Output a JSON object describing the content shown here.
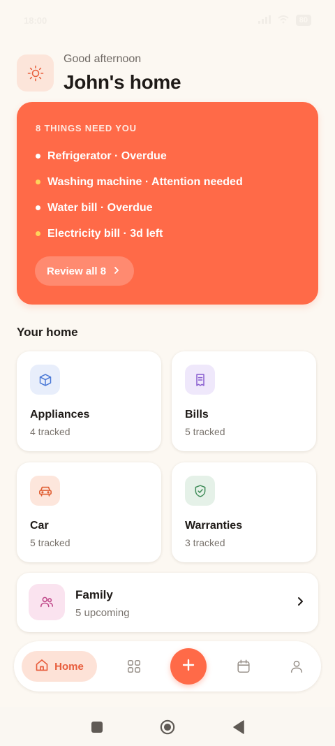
{
  "status_bar": {
    "time": "18:00",
    "battery": "80"
  },
  "header": {
    "greeting": "Good afternoon",
    "title": "John's home"
  },
  "alerts": {
    "heading": "8 THINGS NEED YOU",
    "items": [
      {
        "text": "Refrigerator · Overdue",
        "dot_color": "#FFFFFF"
      },
      {
        "text": "Washing machine · Attention needed",
        "dot_color": "#FFD35C"
      },
      {
        "text": "Water bill · Overdue",
        "dot_color": "#FFFFFF"
      },
      {
        "text": "Electricity bill · 3d left",
        "dot_color": "#FFD35C"
      }
    ],
    "review_label": "Review all 8"
  },
  "section_title": "Your home",
  "tiles": [
    {
      "title": "Appliances",
      "subtitle": "4 tracked",
      "icon": "box-icon",
      "bg": "#E8EEFB",
      "fg": "#4A78D6"
    },
    {
      "title": "Bills",
      "subtitle": "5 tracked",
      "icon": "receipt-icon",
      "bg": "#EFE8FB",
      "fg": "#8A5FD0"
    },
    {
      "title": "Car",
      "subtitle": "5 tracked",
      "icon": "car-icon",
      "bg": "#FDE6DC",
      "fg": "#E06035"
    },
    {
      "title": "Warranties",
      "subtitle": "3 tracked",
      "icon": "shield-check-icon",
      "bg": "#E5F1E8",
      "fg": "#3E8B57"
    }
  ],
  "family": {
    "title": "Family",
    "subtitle": "5 upcoming",
    "icon": "users-icon"
  },
  "bottom_nav": {
    "home_label": "Home"
  },
  "colors": {
    "accent": "#FF6A48",
    "background": "#FCF8F2"
  }
}
